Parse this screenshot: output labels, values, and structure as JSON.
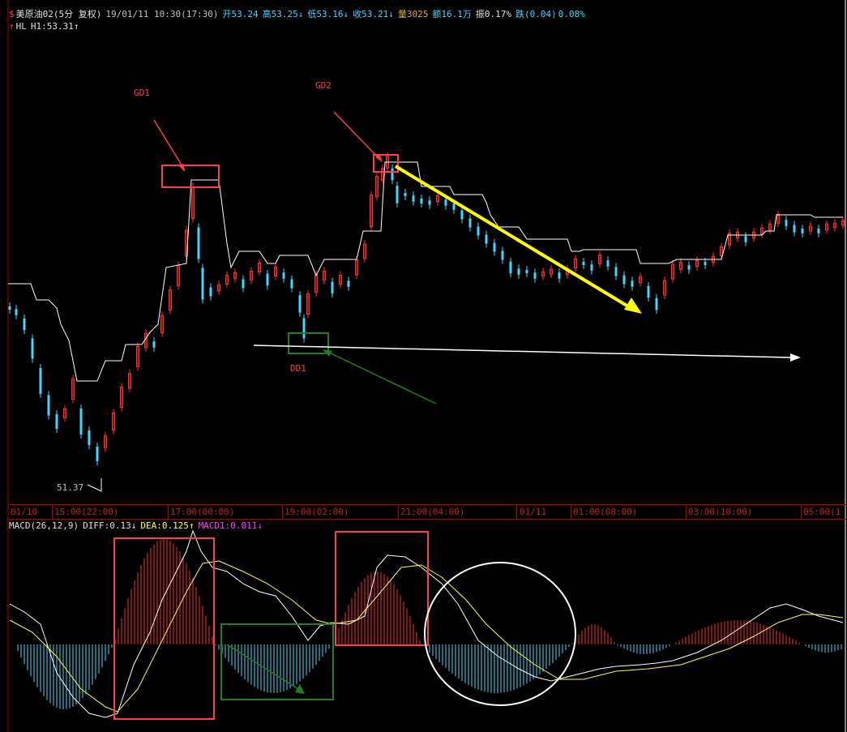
{
  "header": {
    "title": "美原油02(5分 复权)",
    "datetime": "19/01/11 10:30(17:30)",
    "open": "开53.24",
    "high": "高53.25",
    "low": "低53.16",
    "close": "收53.21",
    "volume": "量3025",
    "amount": "额16.1万",
    "amplitude": "振0.17%",
    "change": "跌(0.04)",
    "change_pct": "0.08%"
  },
  "indicator_line": {
    "name": "HL",
    "value": "H1:53.31"
  },
  "price_panel": {
    "low_label": "51.37",
    "annotations": [
      "GD1",
      "GD2",
      "DD1"
    ]
  },
  "time_axis": {
    "labels": [
      "01/10",
      "15:00(22:00)",
      "17:00(00:00)",
      "19:00(02:00)",
      "21:00(04:00)",
      "01/11",
      "01:00(08:00)",
      "03:00(10:00)",
      "05:00(1"
    ]
  },
  "macd_header": {
    "name": "MACD(26,12,9)",
    "diff": "DIFF:0.13",
    "dea": "DEA:0.125",
    "macd": "MACD1:0.011"
  },
  "colors": {
    "up": "#ff3030",
    "down": "#40d8ff",
    "hl_line": "#ffffff",
    "dea_line": "#ffff40",
    "arrow_yellow": "#ffff00",
    "box_red": "#ff4040",
    "box_green": "#208020"
  },
  "icons": {
    "down_arrow": "down-arrow-icon",
    "up_arrow": "up-arrow-icon",
    "dollar": "dollar-icon"
  }
}
